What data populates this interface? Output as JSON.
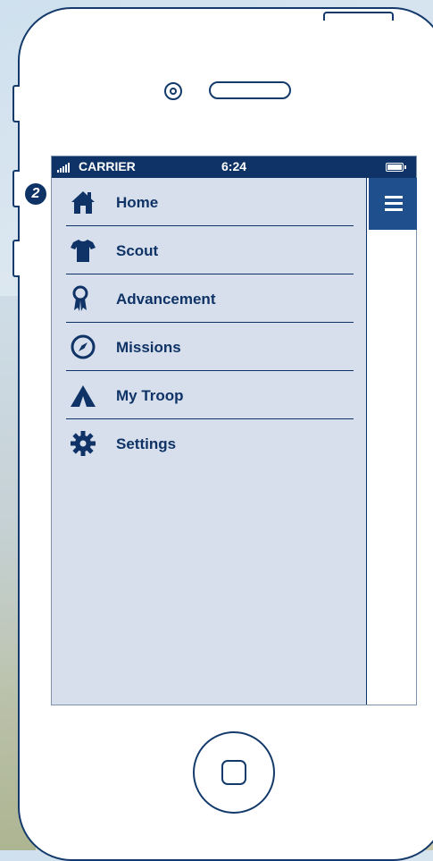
{
  "status_bar": {
    "carrier": "CARRIER",
    "time": "6:24"
  },
  "callout_badge": "2",
  "menu": {
    "items": [
      {
        "label": "Home",
        "icon": "home-icon"
      },
      {
        "label": "Scout",
        "icon": "shirt-icon"
      },
      {
        "label": "Advancement",
        "icon": "award-ribbon-icon"
      },
      {
        "label": "Missions",
        "icon": "compass-icon"
      },
      {
        "label": "My Troop",
        "icon": "tent-icon"
      },
      {
        "label": "Settings",
        "icon": "gear-icon"
      }
    ]
  },
  "colors": {
    "navy": "#0f3366",
    "drawer_bg": "#d6dfeb",
    "menu_button_bg": "#1f4f8c"
  }
}
